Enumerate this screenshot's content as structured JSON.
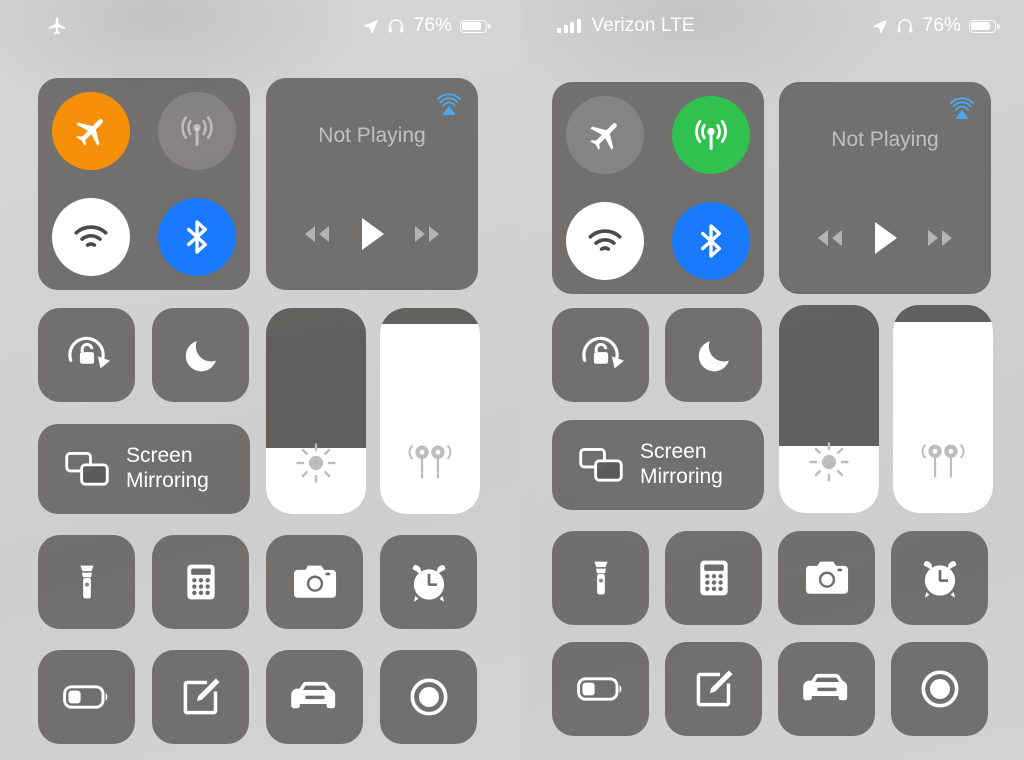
{
  "meta": {
    "app": "iOS Control Center",
    "colors": {
      "tile_bg": "#5a5856",
      "airplane_on": "#f79009",
      "cellular_on": "#30c24f",
      "wifi_on": "#ffffff",
      "bluetooth_on": "#1a7aff",
      "off_circle": "#8a8886",
      "airplay_blue": "#4aa8f0",
      "text_white": "#ffffff"
    }
  },
  "panels": [
    {
      "id": "left",
      "statusbar": {
        "left_icon": "airplane-icon",
        "carrier": "",
        "location_icon": "location-arrow-icon",
        "headphones_icon": "headphones-icon",
        "battery_percent": "76%",
        "battery_level": 76
      },
      "connectivity": {
        "label": "connectivity-module",
        "buttons": [
          {
            "name": "airplane-mode",
            "icon": "airplane-icon",
            "state": "on",
            "color": "#f79009"
          },
          {
            "name": "cellular-data",
            "icon": "cellular-antenna-icon",
            "state": "off",
            "color": "#8a8886"
          },
          {
            "name": "wifi",
            "icon": "wifi-icon",
            "state": "on",
            "color": "#ffffff"
          },
          {
            "name": "bluetooth",
            "icon": "bluetooth-icon",
            "state": "on",
            "color": "#1a7aff"
          }
        ]
      },
      "media": {
        "title": "Not Playing",
        "airplay_icon": "airplay-audio-icon",
        "controls": [
          {
            "name": "rewind-button",
            "icon": "rewind-icon"
          },
          {
            "name": "play-button",
            "icon": "play-icon"
          },
          {
            "name": "fast-forward-button",
            "icon": "fast-forward-icon"
          }
        ]
      },
      "toggles": [
        {
          "name": "rotation-lock",
          "icon": "rotation-lock-icon"
        },
        {
          "name": "do-not-disturb",
          "icon": "moon-icon"
        }
      ],
      "screen_mirroring": {
        "name": "screen-mirroring",
        "icon": "screen-mirroring-icon",
        "line1": "Screen",
        "line2": "Mirroring"
      },
      "sliders": [
        {
          "name": "brightness-slider",
          "icon": "brightness-sun-icon",
          "value": 32
        },
        {
          "name": "volume-slider",
          "icon": "beats-earphones-icon",
          "value": 92
        }
      ],
      "shortcuts": [
        {
          "name": "flashlight",
          "icon": "flashlight-icon"
        },
        {
          "name": "calculator",
          "icon": "calculator-icon"
        },
        {
          "name": "camera",
          "icon": "camera-icon"
        },
        {
          "name": "alarm",
          "icon": "alarm-clock-icon"
        },
        {
          "name": "low-power-mode",
          "icon": "battery-icon"
        },
        {
          "name": "notes",
          "icon": "notes-pencil-icon"
        },
        {
          "name": "car-mode",
          "icon": "car-icon"
        },
        {
          "name": "screen-record",
          "icon": "screen-record-icon"
        }
      ]
    },
    {
      "id": "right",
      "statusbar": {
        "left_icon": "signal-bars-icon",
        "carrier": "Verizon LTE",
        "location_icon": "location-arrow-icon",
        "headphones_icon": "headphones-icon",
        "battery_percent": "76%",
        "battery_level": 76
      },
      "connectivity": {
        "label": "connectivity-module",
        "buttons": [
          {
            "name": "airplane-mode",
            "icon": "airplane-icon",
            "state": "off",
            "color": "#8a8886"
          },
          {
            "name": "cellular-data",
            "icon": "cellular-antenna-icon",
            "state": "on",
            "color": "#30c24f"
          },
          {
            "name": "wifi",
            "icon": "wifi-icon",
            "state": "on",
            "color": "#ffffff"
          },
          {
            "name": "bluetooth",
            "icon": "bluetooth-icon",
            "state": "on",
            "color": "#1a7aff"
          }
        ]
      },
      "media": {
        "title": "Not Playing",
        "airplay_icon": "airplay-audio-icon",
        "controls": [
          {
            "name": "rewind-button",
            "icon": "rewind-icon"
          },
          {
            "name": "play-button",
            "icon": "play-icon"
          },
          {
            "name": "fast-forward-button",
            "icon": "fast-forward-icon"
          }
        ]
      },
      "toggles": [
        {
          "name": "rotation-lock",
          "icon": "rotation-lock-icon"
        },
        {
          "name": "do-not-disturb",
          "icon": "moon-icon"
        }
      ],
      "screen_mirroring": {
        "name": "screen-mirroring",
        "icon": "screen-mirroring-icon",
        "line1": "Screen",
        "line2": "Mirroring"
      },
      "sliders": [
        {
          "name": "brightness-slider",
          "icon": "brightness-sun-icon",
          "value": 32
        },
        {
          "name": "volume-slider",
          "icon": "beats-earphones-icon",
          "value": 92
        }
      ],
      "shortcuts": [
        {
          "name": "flashlight",
          "icon": "flashlight-icon"
        },
        {
          "name": "calculator",
          "icon": "calculator-icon"
        },
        {
          "name": "camera",
          "icon": "camera-icon"
        },
        {
          "name": "alarm",
          "icon": "alarm-clock-icon"
        },
        {
          "name": "low-power-mode",
          "icon": "battery-icon"
        },
        {
          "name": "notes",
          "icon": "notes-pencil-icon"
        },
        {
          "name": "car-mode",
          "icon": "car-icon"
        },
        {
          "name": "screen-record",
          "icon": "screen-record-icon"
        }
      ]
    }
  ]
}
